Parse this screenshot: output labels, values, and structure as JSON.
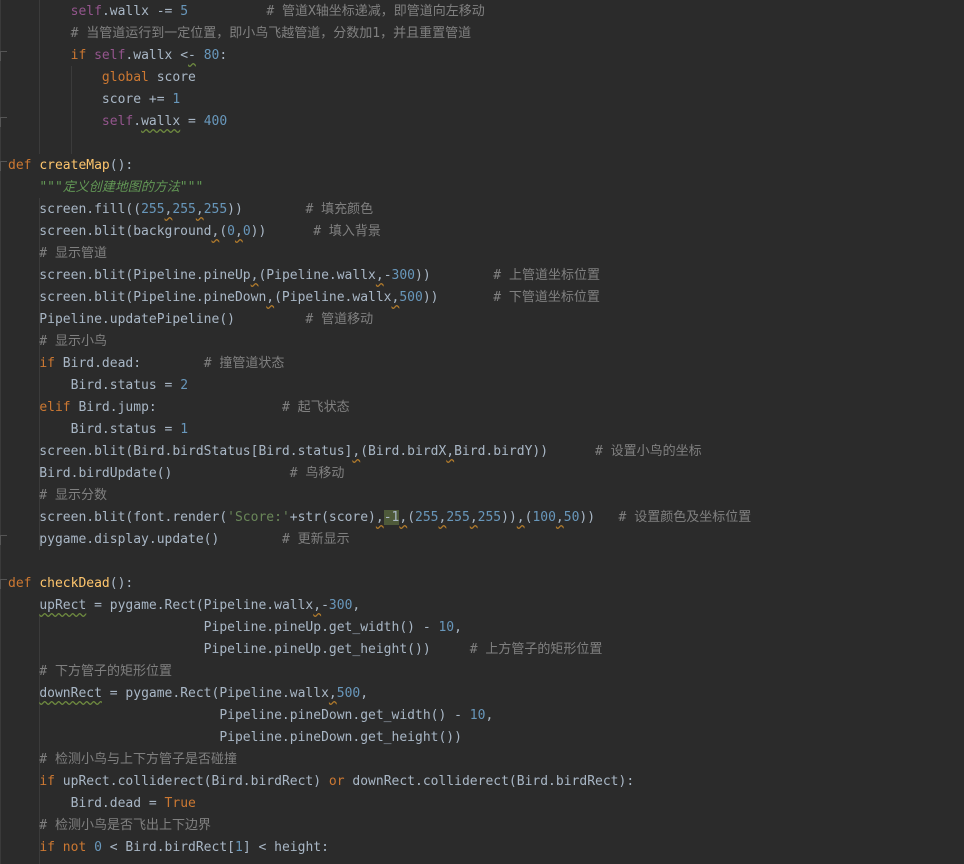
{
  "editor": {
    "language": "python",
    "lines": [
      [
        {
          "t": "        ",
          "c": "var"
        },
        {
          "t": "self",
          "c": "self"
        },
        {
          "t": ".wallx -= ",
          "c": "var"
        },
        {
          "t": "5",
          "c": "num"
        },
        {
          "t": "          # 管道X轴坐标递减，即管道向左移动",
          "c": "cmt"
        }
      ],
      [
        {
          "t": "        # 当管道运行到一定位置，即小鸟飞越管道，分数加1，并且重置管道",
          "c": "cmt"
        }
      ],
      [
        {
          "t": "        ",
          "c": "var"
        },
        {
          "t": "if ",
          "c": "kw"
        },
        {
          "t": "self",
          "c": "self"
        },
        {
          "t": ".wallx <",
          "c": "var"
        },
        {
          "t": "-",
          "c": "squig"
        },
        {
          "t": " ",
          "c": "var"
        },
        {
          "t": "80",
          "c": "num"
        },
        {
          "t": ":",
          "c": "var"
        }
      ],
      [
        {
          "t": "            ",
          "c": "var"
        },
        {
          "t": "global ",
          "c": "kw"
        },
        {
          "t": "score",
          "c": "var"
        }
      ],
      [
        {
          "t": "            score += ",
          "c": "var"
        },
        {
          "t": "1",
          "c": "num"
        }
      ],
      [
        {
          "t": "            ",
          "c": "var"
        },
        {
          "t": "self",
          "c": "self"
        },
        {
          "t": ".",
          "c": "var"
        },
        {
          "t": "wallx",
          "c": "squig"
        },
        {
          "t": " = ",
          "c": "var"
        },
        {
          "t": "400",
          "c": "num"
        }
      ],
      [
        {
          "t": "",
          "c": "var"
        }
      ],
      [
        {
          "t": "def ",
          "c": "kw"
        },
        {
          "t": "createMap",
          "c": "fn"
        },
        {
          "t": "():",
          "c": "var"
        }
      ],
      [
        {
          "t": "    ",
          "c": "var"
        },
        {
          "t": "\"\"\"定义创建地图的方法\"\"\"",
          "c": "doc"
        }
      ],
      [
        {
          "t": "    screen.fill((",
          "c": "var"
        },
        {
          "t": "255",
          "c": "num"
        },
        {
          "t": ",",
          "c": "wavy-comma"
        },
        {
          "t": "255",
          "c": "num"
        },
        {
          "t": ",",
          "c": "wavy-comma"
        },
        {
          "t": "255",
          "c": "num"
        },
        {
          "t": "))        ",
          "c": "var"
        },
        {
          "t": "# 填充颜色",
          "c": "cmt"
        }
      ],
      [
        {
          "t": "    screen.blit(background",
          "c": "var"
        },
        {
          "t": ",",
          "c": "wavy-comma"
        },
        {
          "t": "(",
          "c": "var"
        },
        {
          "t": "0",
          "c": "num"
        },
        {
          "t": ",",
          "c": "wavy-comma"
        },
        {
          "t": "0",
          "c": "num"
        },
        {
          "t": "))      ",
          "c": "var"
        },
        {
          "t": "# 填入背景",
          "c": "cmt"
        }
      ],
      [
        {
          "t": "    # 显示管道",
          "c": "cmt"
        }
      ],
      [
        {
          "t": "    screen.blit(Pipeline.pineUp",
          "c": "var"
        },
        {
          "t": ",",
          "c": "wavy-comma"
        },
        {
          "t": "(Pipeline.wallx",
          "c": "var"
        },
        {
          "t": ",",
          "c": "wavy-comma"
        },
        {
          "t": "-",
          "c": "var"
        },
        {
          "t": "300",
          "c": "num"
        },
        {
          "t": "))        ",
          "c": "var"
        },
        {
          "t": "# 上管道坐标位置",
          "c": "cmt"
        }
      ],
      [
        {
          "t": "    screen.blit(Pipeline.pineDown",
          "c": "var"
        },
        {
          "t": ",",
          "c": "wavy-comma"
        },
        {
          "t": "(Pipeline.wallx",
          "c": "var"
        },
        {
          "t": ",",
          "c": "wavy-comma"
        },
        {
          "t": "500",
          "c": "num"
        },
        {
          "t": "))       ",
          "c": "var"
        },
        {
          "t": "# 下管道坐标位置",
          "c": "cmt"
        }
      ],
      [
        {
          "t": "    Pipeline.updatePipeline()         ",
          "c": "var"
        },
        {
          "t": "# 管道移动",
          "c": "cmt"
        }
      ],
      [
        {
          "t": "    # 显示小鸟",
          "c": "cmt"
        }
      ],
      [
        {
          "t": "    ",
          "c": "var"
        },
        {
          "t": "if ",
          "c": "kw"
        },
        {
          "t": "Bird.dead:        ",
          "c": "var"
        },
        {
          "t": "# 撞管道状态",
          "c": "cmt"
        }
      ],
      [
        {
          "t": "        Bird.status = ",
          "c": "var"
        },
        {
          "t": "2",
          "c": "num"
        }
      ],
      [
        {
          "t": "    ",
          "c": "var"
        },
        {
          "t": "elif ",
          "c": "kw"
        },
        {
          "t": "Bird.jump:                ",
          "c": "var"
        },
        {
          "t": "# 起飞状态",
          "c": "cmt"
        }
      ],
      [
        {
          "t": "        Bird.status = ",
          "c": "var"
        },
        {
          "t": "1",
          "c": "num"
        }
      ],
      [
        {
          "t": "    screen.blit(Bird.birdStatus[Bird.status]",
          "c": "var"
        },
        {
          "t": ",",
          "c": "wavy-comma"
        },
        {
          "t": "(Bird.birdX",
          "c": "var"
        },
        {
          "t": ",",
          "c": "wavy-comma"
        },
        {
          "t": "Bird.birdY))      ",
          "c": "var"
        },
        {
          "t": "# 设置小鸟的坐标",
          "c": "cmt"
        }
      ],
      [
        {
          "t": "    Bird.birdUpdate()               ",
          "c": "var"
        },
        {
          "t": "# 鸟移动",
          "c": "cmt"
        }
      ],
      [
        {
          "t": "    # 显示分数",
          "c": "cmt"
        }
      ],
      [
        {
          "t": "    screen.blit(font.render(",
          "c": "var"
        },
        {
          "t": "'Score:'",
          "c": "str"
        },
        {
          "t": "+str(score)",
          "c": "var"
        },
        {
          "t": ",",
          "c": "wavy-comma"
        },
        {
          "t": "-1",
          "c": "hl"
        },
        {
          "t": ",",
          "c": "wavy-comma"
        },
        {
          "t": "(",
          "c": "var"
        },
        {
          "t": "255",
          "c": "num"
        },
        {
          "t": ",",
          "c": "wavy-comma"
        },
        {
          "t": "255",
          "c": "num"
        },
        {
          "t": ",",
          "c": "wavy-comma"
        },
        {
          "t": "255",
          "c": "num"
        },
        {
          "t": "))",
          "c": "var"
        },
        {
          "t": ",",
          "c": "wavy-comma"
        },
        {
          "t": "(",
          "c": "var"
        },
        {
          "t": "100",
          "c": "num"
        },
        {
          "t": ",",
          "c": "wavy-comma"
        },
        {
          "t": "50",
          "c": "num"
        },
        {
          "t": "))   ",
          "c": "var"
        },
        {
          "t": "# 设置颜色及坐标位置",
          "c": "cmt"
        }
      ],
      [
        {
          "t": "    pygame.display.update()        ",
          "c": "var"
        },
        {
          "t": "# 更新显示",
          "c": "cmt"
        }
      ],
      [
        {
          "t": "",
          "c": "var"
        }
      ],
      [
        {
          "t": "def ",
          "c": "kw"
        },
        {
          "t": "checkDead",
          "c": "fn"
        },
        {
          "t": "():",
          "c": "var"
        }
      ],
      [
        {
          "t": "    ",
          "c": "var"
        },
        {
          "t": "upRect",
          "c": "squig"
        },
        {
          "t": " = pygame.Rect(Pipeline.wallx",
          "c": "var"
        },
        {
          "t": ",",
          "c": "wavy-comma"
        },
        {
          "t": "-",
          "c": "var"
        },
        {
          "t": "300",
          "c": "num"
        },
        {
          "t": ",",
          "c": "var"
        }
      ],
      [
        {
          "t": "                         Pipeline.pineUp.get_width() - ",
          "c": "var"
        },
        {
          "t": "10",
          "c": "num"
        },
        {
          "t": ",",
          "c": "var"
        }
      ],
      [
        {
          "t": "                         Pipeline.pineUp.get_height())     ",
          "c": "var"
        },
        {
          "t": "# 上方管子的矩形位置",
          "c": "cmt"
        }
      ],
      [
        {
          "t": "    # 下方管子的矩形位置",
          "c": "cmt"
        }
      ],
      [
        {
          "t": "    ",
          "c": "var"
        },
        {
          "t": "downRect",
          "c": "squig"
        },
        {
          "t": " = pygame.Rect(Pipeline.wallx",
          "c": "var"
        },
        {
          "t": ",",
          "c": "wavy-comma"
        },
        {
          "t": "500",
          "c": "num"
        },
        {
          "t": ",",
          "c": "var"
        }
      ],
      [
        {
          "t": "                           Pipeline.pineDown.get_width() - ",
          "c": "var"
        },
        {
          "t": "10",
          "c": "num"
        },
        {
          "t": ",",
          "c": "var"
        }
      ],
      [
        {
          "t": "                           Pipeline.pineDown.get_height())",
          "c": "var"
        }
      ],
      [
        {
          "t": "    # 检测小鸟与上下方管子是否碰撞",
          "c": "cmt"
        }
      ],
      [
        {
          "t": "    ",
          "c": "var"
        },
        {
          "t": "if ",
          "c": "kw"
        },
        {
          "t": "upRect.colliderect(Bird.birdRect) ",
          "c": "var"
        },
        {
          "t": "or ",
          "c": "kw"
        },
        {
          "t": "downRect.colliderect(Bird.birdRect):",
          "c": "var"
        }
      ],
      [
        {
          "t": "        Bird.dead = ",
          "c": "var"
        },
        {
          "t": "True",
          "c": "kw"
        }
      ],
      [
        {
          "t": "    # 检测小鸟是否飞出上下边界",
          "c": "cmt"
        }
      ],
      [
        {
          "t": "    ",
          "c": "var"
        },
        {
          "t": "if not ",
          "c": "kw"
        },
        {
          "t": "0",
          "c": "num"
        },
        {
          "t": " < Bird.birdRect[",
          "c": "var"
        },
        {
          "t": "1",
          "c": "num"
        },
        {
          "t": "] < height:",
          "c": "var"
        }
      ]
    ]
  }
}
